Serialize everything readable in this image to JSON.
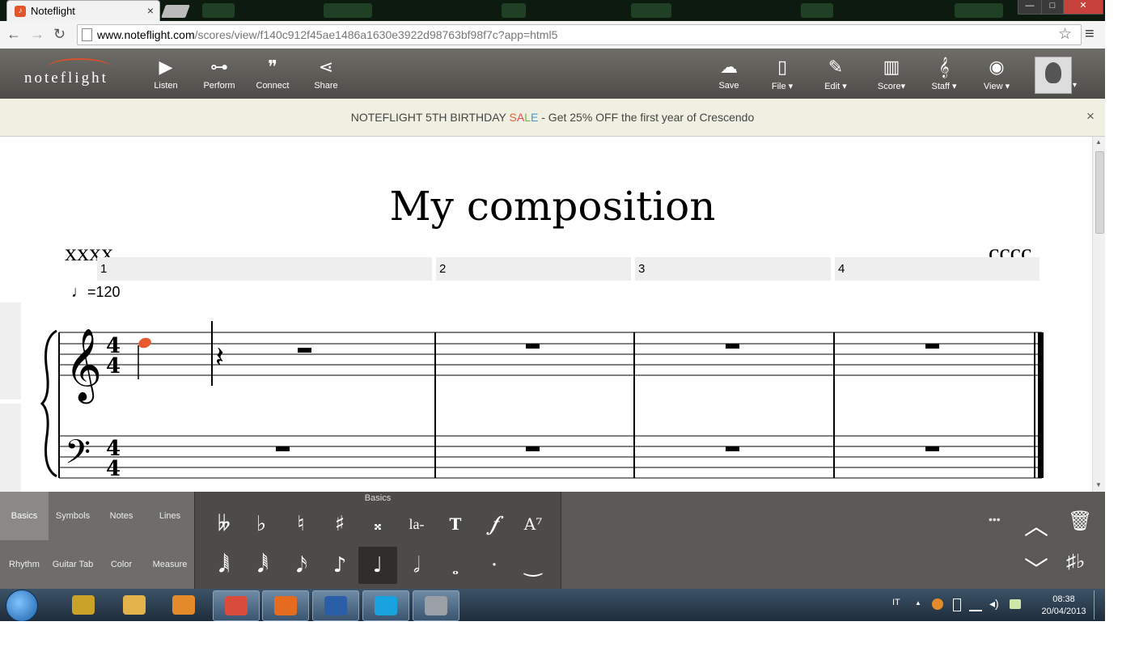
{
  "browser": {
    "tab_title": "Noteflight",
    "tab_close": "×",
    "url_host": "www.noteflight.com",
    "url_path": "/scores/view/f140c912f45ae1486a1630e3922d98763bf98f7c?app=html5",
    "back_icon": "←",
    "forward_icon": "→",
    "reload_icon": "↻",
    "star_icon": "☆",
    "menu_icon": "≡",
    "win_min": "—",
    "win_max": "□",
    "win_close": "✕"
  },
  "toolbar": {
    "logo": "noteflight",
    "left": [
      {
        "label": "Listen",
        "icon": "play-icon",
        "glyph": "▶"
      },
      {
        "label": "Perform",
        "icon": "trumpet-icon",
        "glyph": "⊶"
      },
      {
        "label": "Connect",
        "icon": "connect-icon",
        "glyph": "❞"
      },
      {
        "label": "Share",
        "icon": "share-icon",
        "glyph": "⋖"
      }
    ],
    "right": [
      {
        "label": "Save",
        "icon": "cloud-upload-icon",
        "glyph": "☁"
      },
      {
        "label": "File ▾",
        "icon": "file-icon",
        "glyph": "▯"
      },
      {
        "label": "Edit ▾",
        "icon": "pencil-icon",
        "glyph": "✎"
      },
      {
        "label": "Score▾",
        "icon": "score-icon",
        "glyph": "▥"
      },
      {
        "label": "Staff ▾",
        "icon": "staff-icon",
        "glyph": "𝄞"
      },
      {
        "label": "View ▾",
        "icon": "eye-icon",
        "glyph": "◉"
      }
    ],
    "avatar_caret": "▾"
  },
  "banner": {
    "pre": "NOTEFLIGHT 5TH BIRTHDAY ",
    "s": "S",
    "a": "A",
    "l": "L",
    "e": "E",
    "post": " - Get 25% OFF the first year of Crescendo",
    "close": "×"
  },
  "score": {
    "title": "My composition",
    "subtitle": "xxxx",
    "composer": "cccc",
    "measures": [
      "1",
      "2",
      "3",
      "4"
    ],
    "tempo": "=120",
    "time_signature": {
      "top": "4",
      "bottom": "4"
    },
    "note_color": "#e85a2a"
  },
  "palette": {
    "categories": [
      {
        "label": "Basics",
        "selected": true
      },
      {
        "label": "Symbols",
        "selected": false
      },
      {
        "label": "Notes",
        "selected": false
      },
      {
        "label": "Lines",
        "selected": false
      },
      {
        "label": "Rhythm",
        "selected": false
      },
      {
        "label": "Guitar Tab",
        "selected": false
      },
      {
        "label": "Color",
        "selected": false
      },
      {
        "label": "Measure",
        "selected": false
      }
    ],
    "header": "Basics",
    "row1": [
      {
        "name": "double-flat-icon",
        "glyph": "𝄫"
      },
      {
        "name": "flat-icon",
        "glyph": "♭"
      },
      {
        "name": "natural-icon",
        "glyph": "♮"
      },
      {
        "name": "sharp-icon",
        "glyph": "♯"
      },
      {
        "name": "double-sharp-icon",
        "glyph": "𝄪"
      },
      {
        "name": "lyric-icon",
        "glyph": "la-"
      },
      {
        "name": "text-icon",
        "glyph": "T"
      },
      {
        "name": "dynamics-icon",
        "glyph": "𝆑"
      },
      {
        "name": "chord-symbol-icon",
        "glyph": "A⁷"
      }
    ],
    "row2": [
      {
        "name": "sixtyfourth-note-icon",
        "glyph": "𝅘𝅥𝅲"
      },
      {
        "name": "thirtysecond-note-icon",
        "glyph": "𝅘𝅥𝅱"
      },
      {
        "name": "sixteenth-note-icon",
        "glyph": "𝅘𝅥𝅯"
      },
      {
        "name": "eighth-note-icon",
        "glyph": "♪"
      },
      {
        "name": "quarter-note-icon",
        "glyph": "♩",
        "selected": true
      },
      {
        "name": "half-note-icon",
        "glyph": "𝅗𝅥"
      },
      {
        "name": "whole-note-icon",
        "glyph": "𝅝"
      },
      {
        "name": "dot-icon",
        "glyph": "·"
      },
      {
        "name": "tie-icon",
        "glyph": "‿"
      }
    ],
    "right": {
      "more": "•••",
      "up": "︿",
      "trash": "🗑",
      "down": "﹀",
      "enharmonic": "♯♭"
    }
  },
  "taskbar": {
    "apps": [
      {
        "name": "markers-app",
        "color": "#c9a227",
        "open": false
      },
      {
        "name": "explorer-app",
        "color": "#e3b24a",
        "open": false
      },
      {
        "name": "media-player-app",
        "color": "#e48a2a",
        "open": false
      },
      {
        "name": "chrome-app",
        "color": "#d94b3b",
        "open": true
      },
      {
        "name": "firefox-app",
        "color": "#e56b1f",
        "open": true
      },
      {
        "name": "word-app",
        "color": "#2b5ea8",
        "open": true
      },
      {
        "name": "skype-app",
        "color": "#18a3e0",
        "open": true
      },
      {
        "name": "paint-app",
        "color": "#9aa0a6",
        "open": true
      }
    ],
    "lang": "IT",
    "tray_up": "▲",
    "time": "08:38",
    "date": "20/04/2013"
  }
}
